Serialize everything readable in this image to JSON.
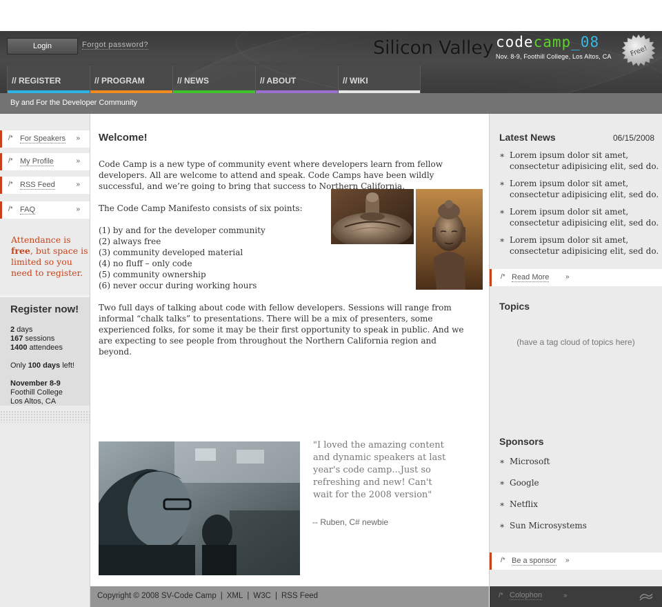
{
  "header": {
    "login_label": "Login",
    "forgot_label": "Forgot password?",
    "brand_region": "Silicon Valley",
    "logo_code": "code",
    "logo_camp": "camp",
    "logo_year": "_08",
    "event_dates": "Nov. 8-9, Foothill College, Los Altos, CA",
    "free_badge": "Free!"
  },
  "nav": {
    "tabs": [
      {
        "label": "// REGISTER",
        "color": "#2eb4e6"
      },
      {
        "label": "// PROGRAM",
        "color": "#f28c1e"
      },
      {
        "label": "// NEWS",
        "color": "#3cc42a"
      },
      {
        "label": "// ABOUT",
        "color": "#9a6fcf"
      },
      {
        "label": "// WIKI",
        "color": "#e6e6e6"
      }
    ]
  },
  "tagline": "By and For the Developer Community",
  "left": {
    "links": [
      {
        "prefix": "/*",
        "label": "For Speakers",
        "arrow": "»"
      },
      {
        "prefix": "/*",
        "label": "My Profile",
        "arrow": "»"
      },
      {
        "prefix": "/*",
        "label": "RSS Feed",
        "arrow": "»"
      },
      {
        "prefix": "/*",
        "label": "FAQ",
        "arrow": "»"
      }
    ],
    "attendance_pre": "Attendance is ",
    "attendance_bold": "free",
    "attendance_post": ", but space is limited so you need to register.",
    "register": {
      "title": "Register now!",
      "days_num": "2",
      "days_txt": " days",
      "sessions_num": "167",
      "sessions_txt": " sessions",
      "attendees_num": "1400",
      "attendees_txt": " attendees",
      "only_pre": "Only ",
      "only_bold": "100 days",
      "only_post": " left!",
      "date_bold": "November 8-9",
      "venue1": "Foothill College",
      "venue2": "Los Altos, CA"
    }
  },
  "main": {
    "welcome": "Welcome!",
    "intro": "Code Camp is a new type of community event where developers learn from fellow developers. All are welcome to attend and speak. Code Camps have been wildly successful, and we’re going to bring that success to Northern California.",
    "manifesto_intro": "The Code Camp Manifesto consists of six points:",
    "manifesto": [
      "(1) by and for the developer community",
      "(2) always free",
      "(3) community developed material",
      "(4) no fluff – only code",
      "(5) community ownership",
      "(6) never occur during working hours"
    ],
    "details": "Two full days of talking about code with fellow developers. Sessions will range from informal “chalk talks” to presentations. There will be a mix of presenters, some experienced folks, for some it may be their first opportunity to speak in public. And we are expecting to see people from throughout the Northern California region and beyond.",
    "quote": "\"I loved the amazing content and dynamic speakers at last year's code camp...Just so refreshing and new! Can't wait for the 2008 version\"",
    "quote_by": "-- Ruben, C# newbie"
  },
  "right": {
    "news_title": "Latest News",
    "news_date": "06/15/2008",
    "news_items": [
      "Lorem ipsum dolor sit amet, consectetur adipisicing elit, sed do.",
      "Lorem ipsum dolor sit amet, consectetur adipisicing elit, sed do.",
      "Lorem ipsum dolor sit amet, consectetur adipisicing elit, sed do.",
      "Lorem ipsum dolor sit amet, consectetur adipisicing elit, sed do."
    ],
    "read_more": {
      "prefix": "/*",
      "label": "Read More",
      "arrow": "»"
    },
    "topics_title": "Topics",
    "topics_placeholder": "(have a tag cloud of topics here)",
    "sponsors_title": "Sponsors",
    "sponsors": [
      "Microsoft",
      "Google",
      "Netflix",
      "Sun Microsystems"
    ],
    "be_sponsor": {
      "prefix": "/*",
      "label": "Be a sponsor",
      "arrow": "»"
    }
  },
  "footer": {
    "copyright": "Copyright © 2008 SV-Code Camp",
    "links": [
      "XML",
      "W3C",
      "RSS Feed"
    ],
    "separator": "|",
    "colophon": {
      "prefix": "/*",
      "label": "Colophon",
      "arrow": "»"
    }
  },
  "colors": {
    "accent": "#c8431a",
    "header_bg": "#404040",
    "tagline_bg": "#737373"
  }
}
